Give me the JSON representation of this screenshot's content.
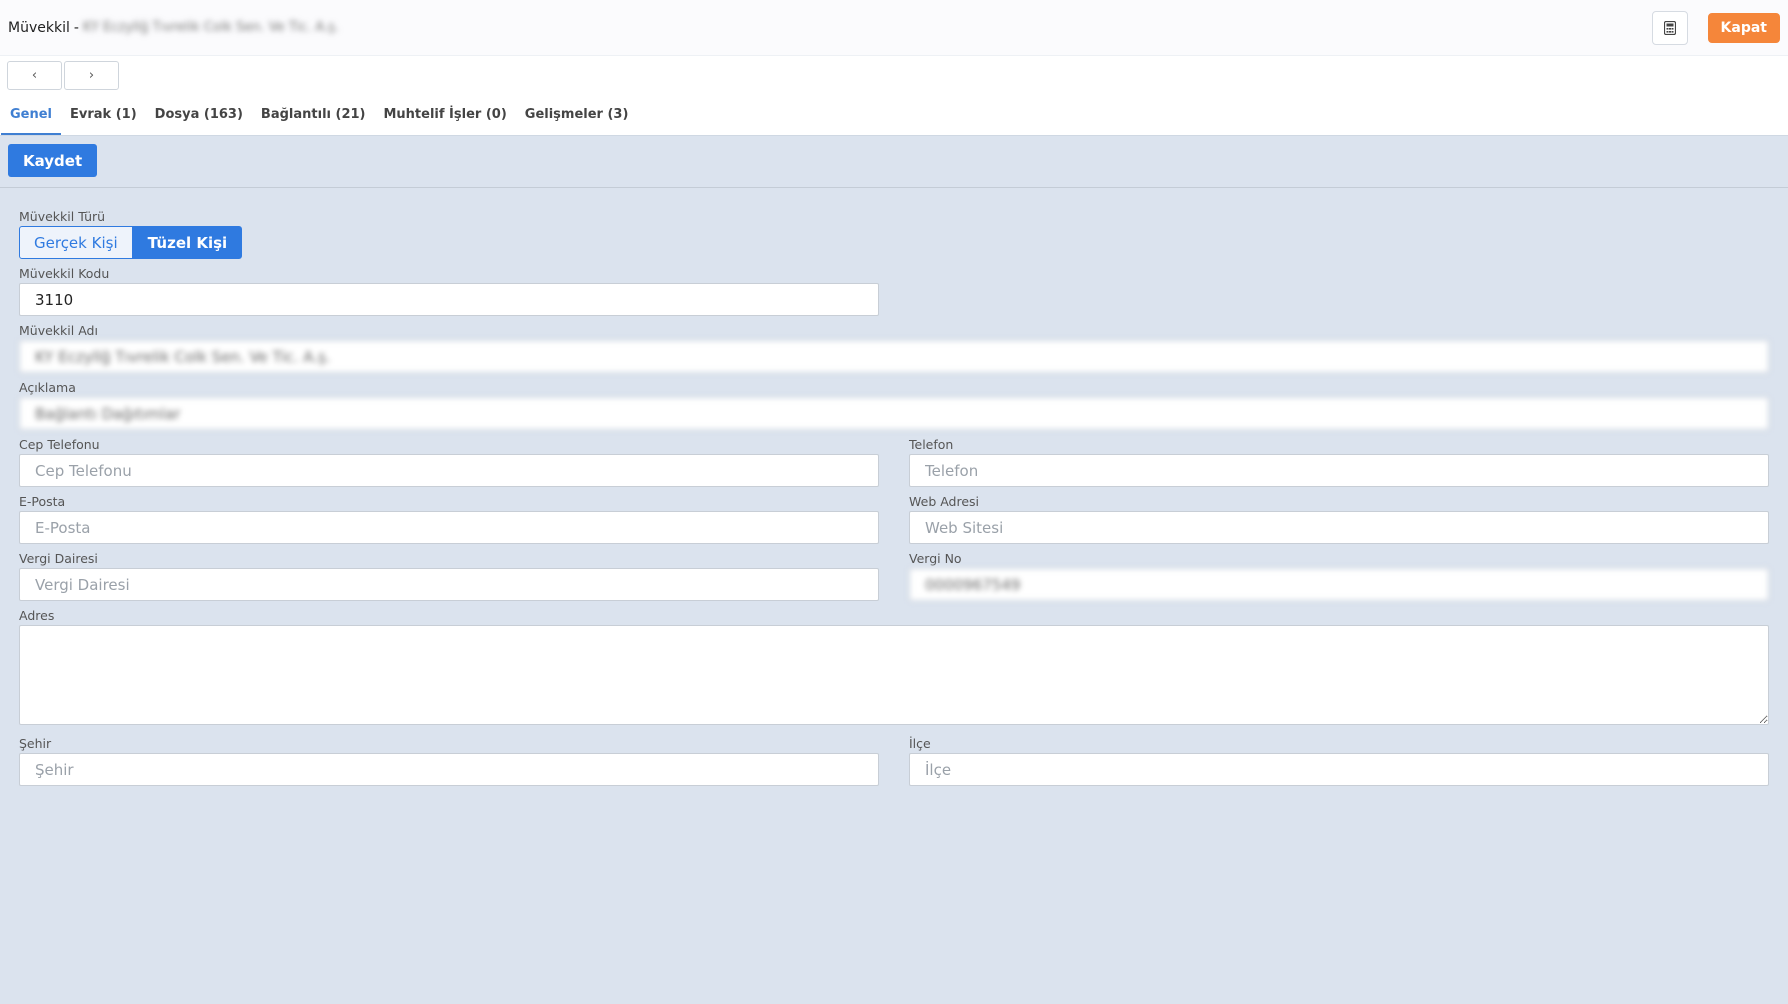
{
  "header": {
    "title": "Müvekkil",
    "separator": "-",
    "client_name": "KY Eczyllğ Tıvrelik Colk Sen. Ve Tic. A.ş.",
    "close_label": "Kapat",
    "calculator_icon": "calculator-icon"
  },
  "nav": {
    "prev_label": "‹",
    "next_label": "›"
  },
  "tabs": [
    {
      "label": "Genel",
      "active": true
    },
    {
      "label": "Evrak (1)",
      "active": false
    },
    {
      "label": "Dosya (163)",
      "active": false
    },
    {
      "label": "Bağlantılı (21)",
      "active": false
    },
    {
      "label": "Muhtelif İşler (0)",
      "active": false
    },
    {
      "label": "Gelişmeler (3)",
      "active": false
    }
  ],
  "toolbar": {
    "save_label": "Kaydet"
  },
  "form": {
    "type": {
      "label": "Müvekkil Türü",
      "options": [
        "Gerçek Kişi",
        "Tüzel Kişi"
      ],
      "selected": "Tüzel Kişi"
    },
    "code": {
      "label": "Müvekkil Kodu",
      "value": "3110"
    },
    "name": {
      "label": "Müvekkil Adı",
      "value": "KY Eczyllğ Tıvrelik Colk Sen. Ve Tic. A.ş."
    },
    "description": {
      "label": "Açıklama",
      "value": "Bağlantı Dağıtımlar"
    },
    "mobile": {
      "label": "Cep Telefonu",
      "placeholder": "Cep Telefonu",
      "value": ""
    },
    "phone": {
      "label": "Telefon",
      "placeholder": "Telefon",
      "value": ""
    },
    "email": {
      "label": "E-Posta",
      "placeholder": "E-Posta",
      "value": ""
    },
    "web": {
      "label": "Web Adresi",
      "placeholder": "Web Sitesi",
      "value": ""
    },
    "tax_office": {
      "label": "Vergi Dairesi",
      "placeholder": "Vergi Dairesi",
      "value": ""
    },
    "tax_no": {
      "label": "Vergi No",
      "value": "0000967549"
    },
    "address": {
      "label": "Adres",
      "value": ""
    },
    "city": {
      "label": "Şehir",
      "placeholder": "Şehir",
      "value": ""
    },
    "district": {
      "label": "İlçe",
      "placeholder": "İlçe",
      "value": ""
    }
  },
  "colors": {
    "primary": "#2f7ae0",
    "accent": "#f5863a",
    "background": "#dbe3ee"
  }
}
